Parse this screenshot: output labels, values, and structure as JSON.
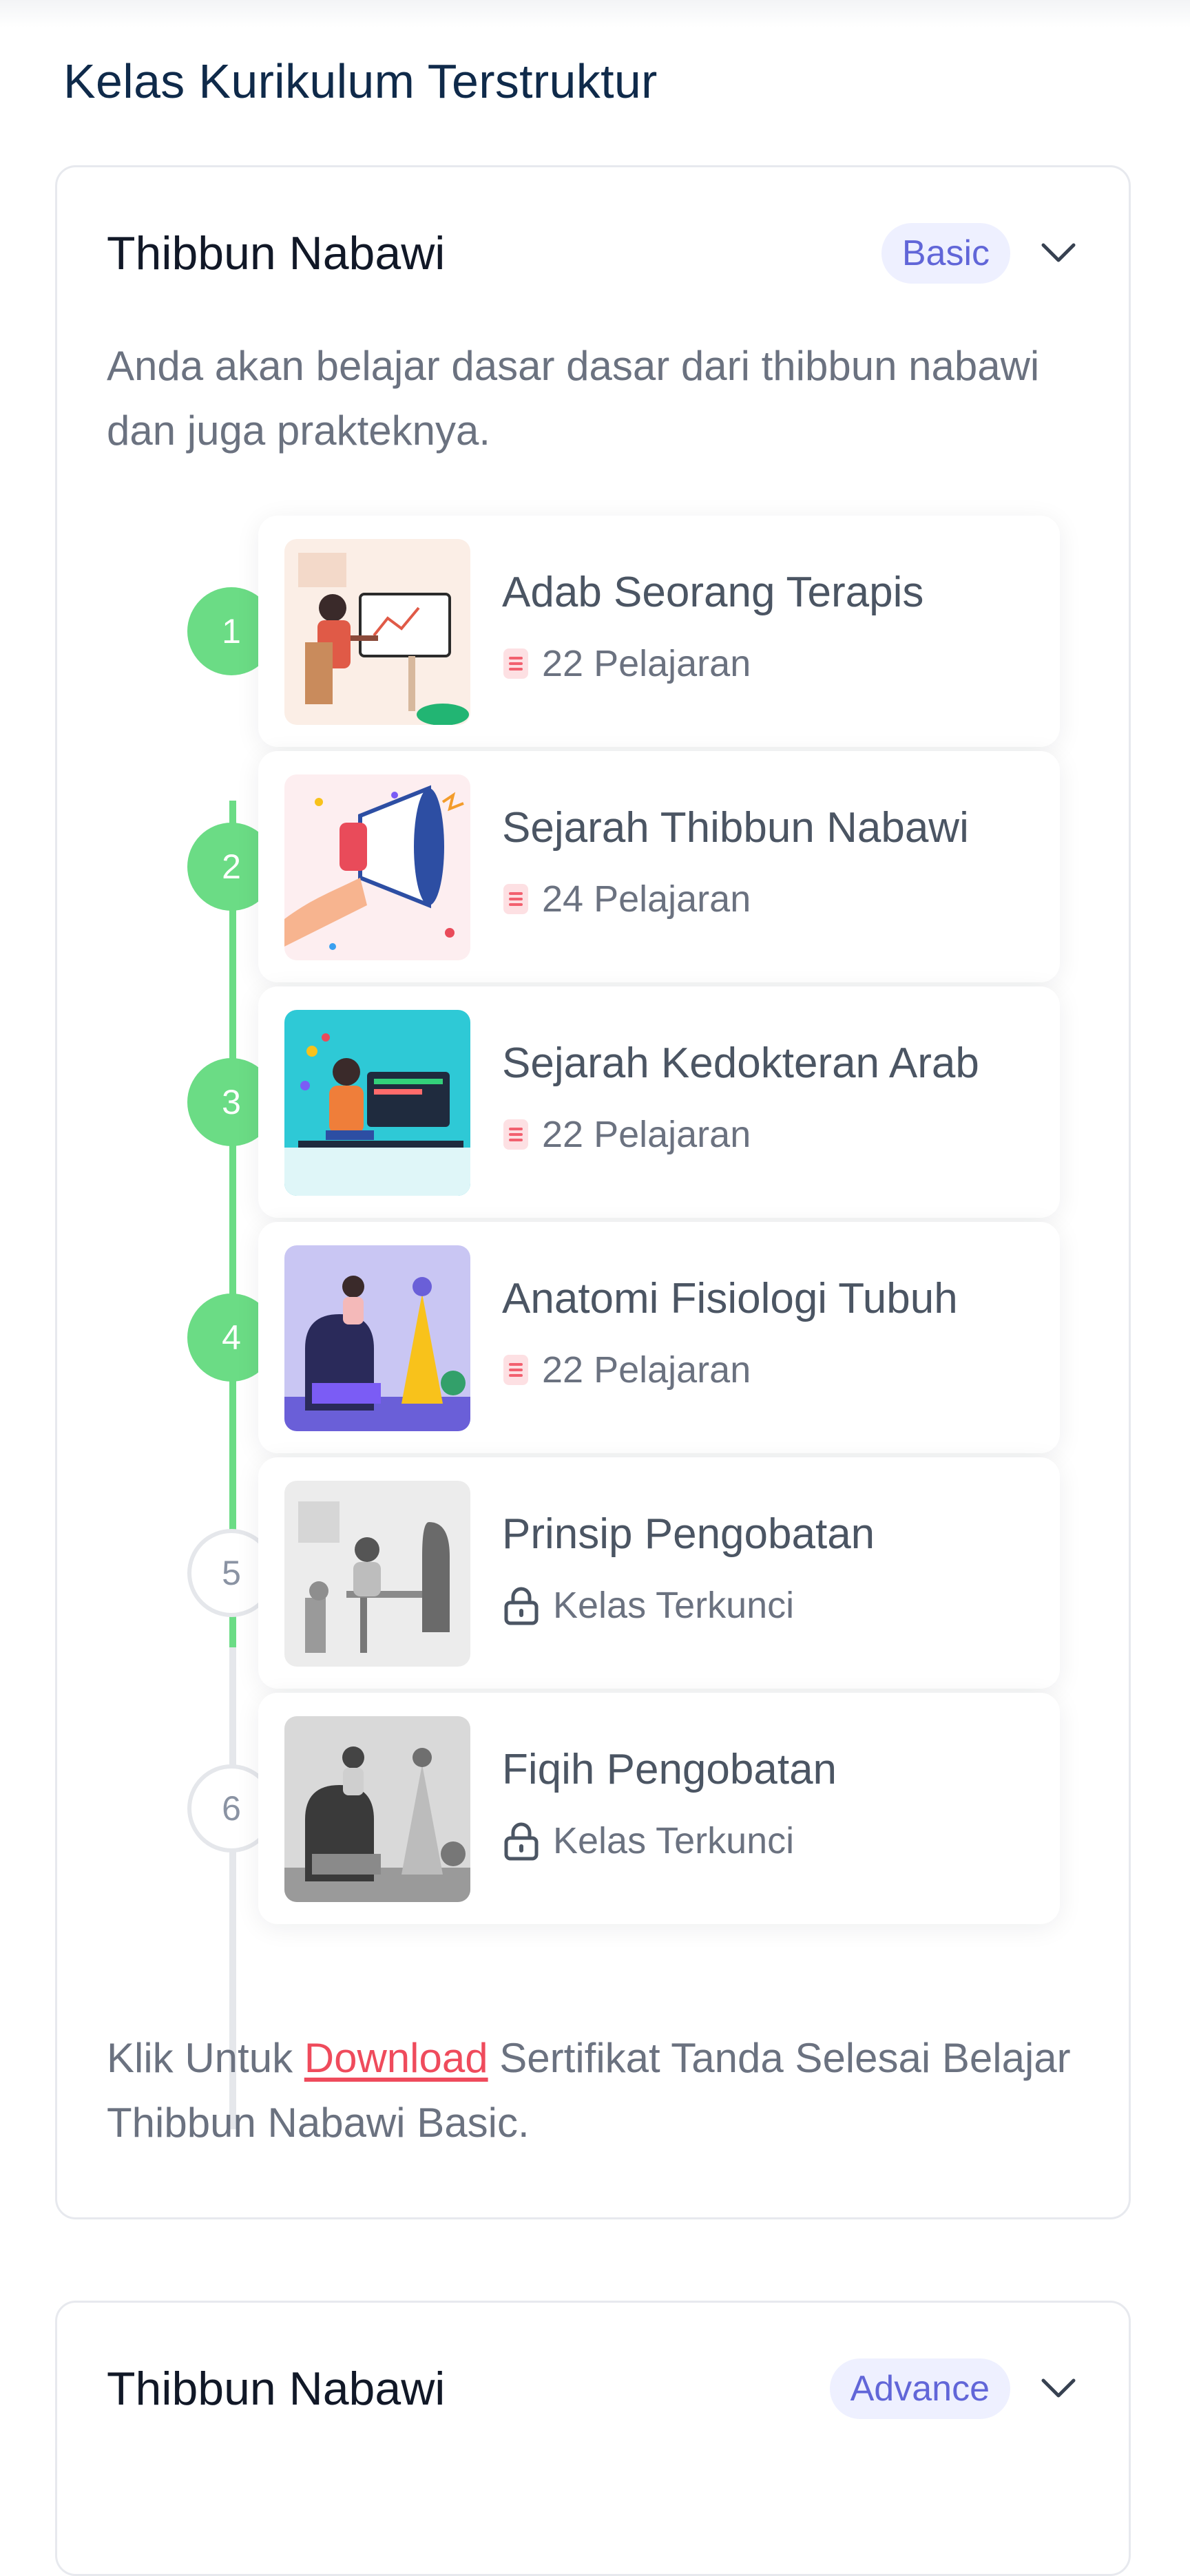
{
  "section": {
    "title": "Kelas Kurikulum Terstruktur"
  },
  "courses": [
    {
      "title": "Thibbun Nabawi",
      "level": "Basic",
      "description": "Anda akan belajar dasar dasar dari thibbun nabawi dan juga prakteknya.",
      "lessons": [
        {
          "step": "1",
          "title": "Adab Seorang Terapis",
          "meta": "22 Pelajaran",
          "status": "completed"
        },
        {
          "step": "2",
          "title": "Sejarah Thibbun Nabawi",
          "meta": "24 Pelajaran",
          "status": "completed"
        },
        {
          "step": "3",
          "title": "Sejarah Kedokteran Arab",
          "meta": "22 Pelajaran",
          "status": "completed"
        },
        {
          "step": "4",
          "title": "Anatomi Fisiologi Tubuh",
          "meta": "22 Pelajaran",
          "status": "completed"
        },
        {
          "step": "5",
          "title": "Prinsip Pengobatan",
          "meta": "Kelas Terkunci",
          "status": "locked"
        },
        {
          "step": "6",
          "title": "Fiqih Pengobatan",
          "meta": "Kelas Terkunci",
          "status": "locked"
        }
      ],
      "footer": {
        "prefix": "Klik Untuk ",
        "link": "Download",
        "suffix": " Sertifikat Tanda Selesai Belajar Thibbun Nabawi Basic."
      }
    },
    {
      "title": "Thibbun Nabawi",
      "level": "Advance"
    }
  ],
  "colors": {
    "accent_green": "#6bdc85",
    "badge_text": "#6166d8",
    "badge_bg": "#eef0ff",
    "link_red": "#ef4b5c",
    "title_navy": "#0f2a4a"
  },
  "icons": [
    "chevron-down-icon",
    "document-icon",
    "lock-icon"
  ]
}
